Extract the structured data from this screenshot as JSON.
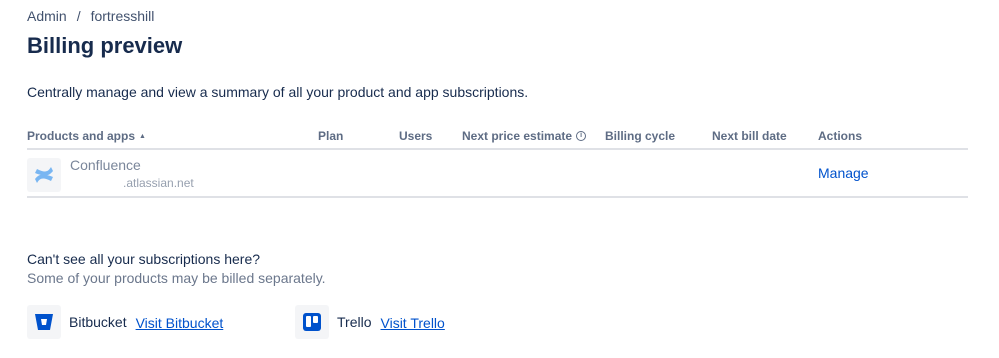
{
  "breadcrumb": {
    "items": [
      "Admin",
      "fortresshill"
    ],
    "separator": "/"
  },
  "page": {
    "title": "Billing preview",
    "description": "Centrally manage and view a summary of all your product and app subscriptions."
  },
  "table": {
    "columns": [
      "Products and apps",
      "Plan",
      "Users",
      "Next price estimate",
      "Billing cycle",
      "Next bill date",
      "Actions"
    ],
    "rows": [
      {
        "product": "Confluence",
        "site": ".atlassian.net",
        "icon": "confluence-icon",
        "plan": "",
        "users": "",
        "next_price_estimate": "",
        "billing_cycle": "",
        "next_bill_date": "",
        "action": "Manage"
      }
    ]
  },
  "missing": {
    "title": "Can't see all your subscriptions here?",
    "subtitle": "Some of your products may be billed separately."
  },
  "other_products": [
    {
      "name": "Bitbucket",
      "link": "Visit Bitbucket",
      "icon": "bitbucket-icon"
    },
    {
      "name": "Trello",
      "link": "Visit Trello",
      "icon": "trello-icon"
    }
  ],
  "colors": {
    "text": "#172b4d",
    "subtle": "#6b778c",
    "link": "#0052cc",
    "border": "#dfe1e6",
    "brand": "#0052cc",
    "muted_logo": "#79b6f2"
  }
}
